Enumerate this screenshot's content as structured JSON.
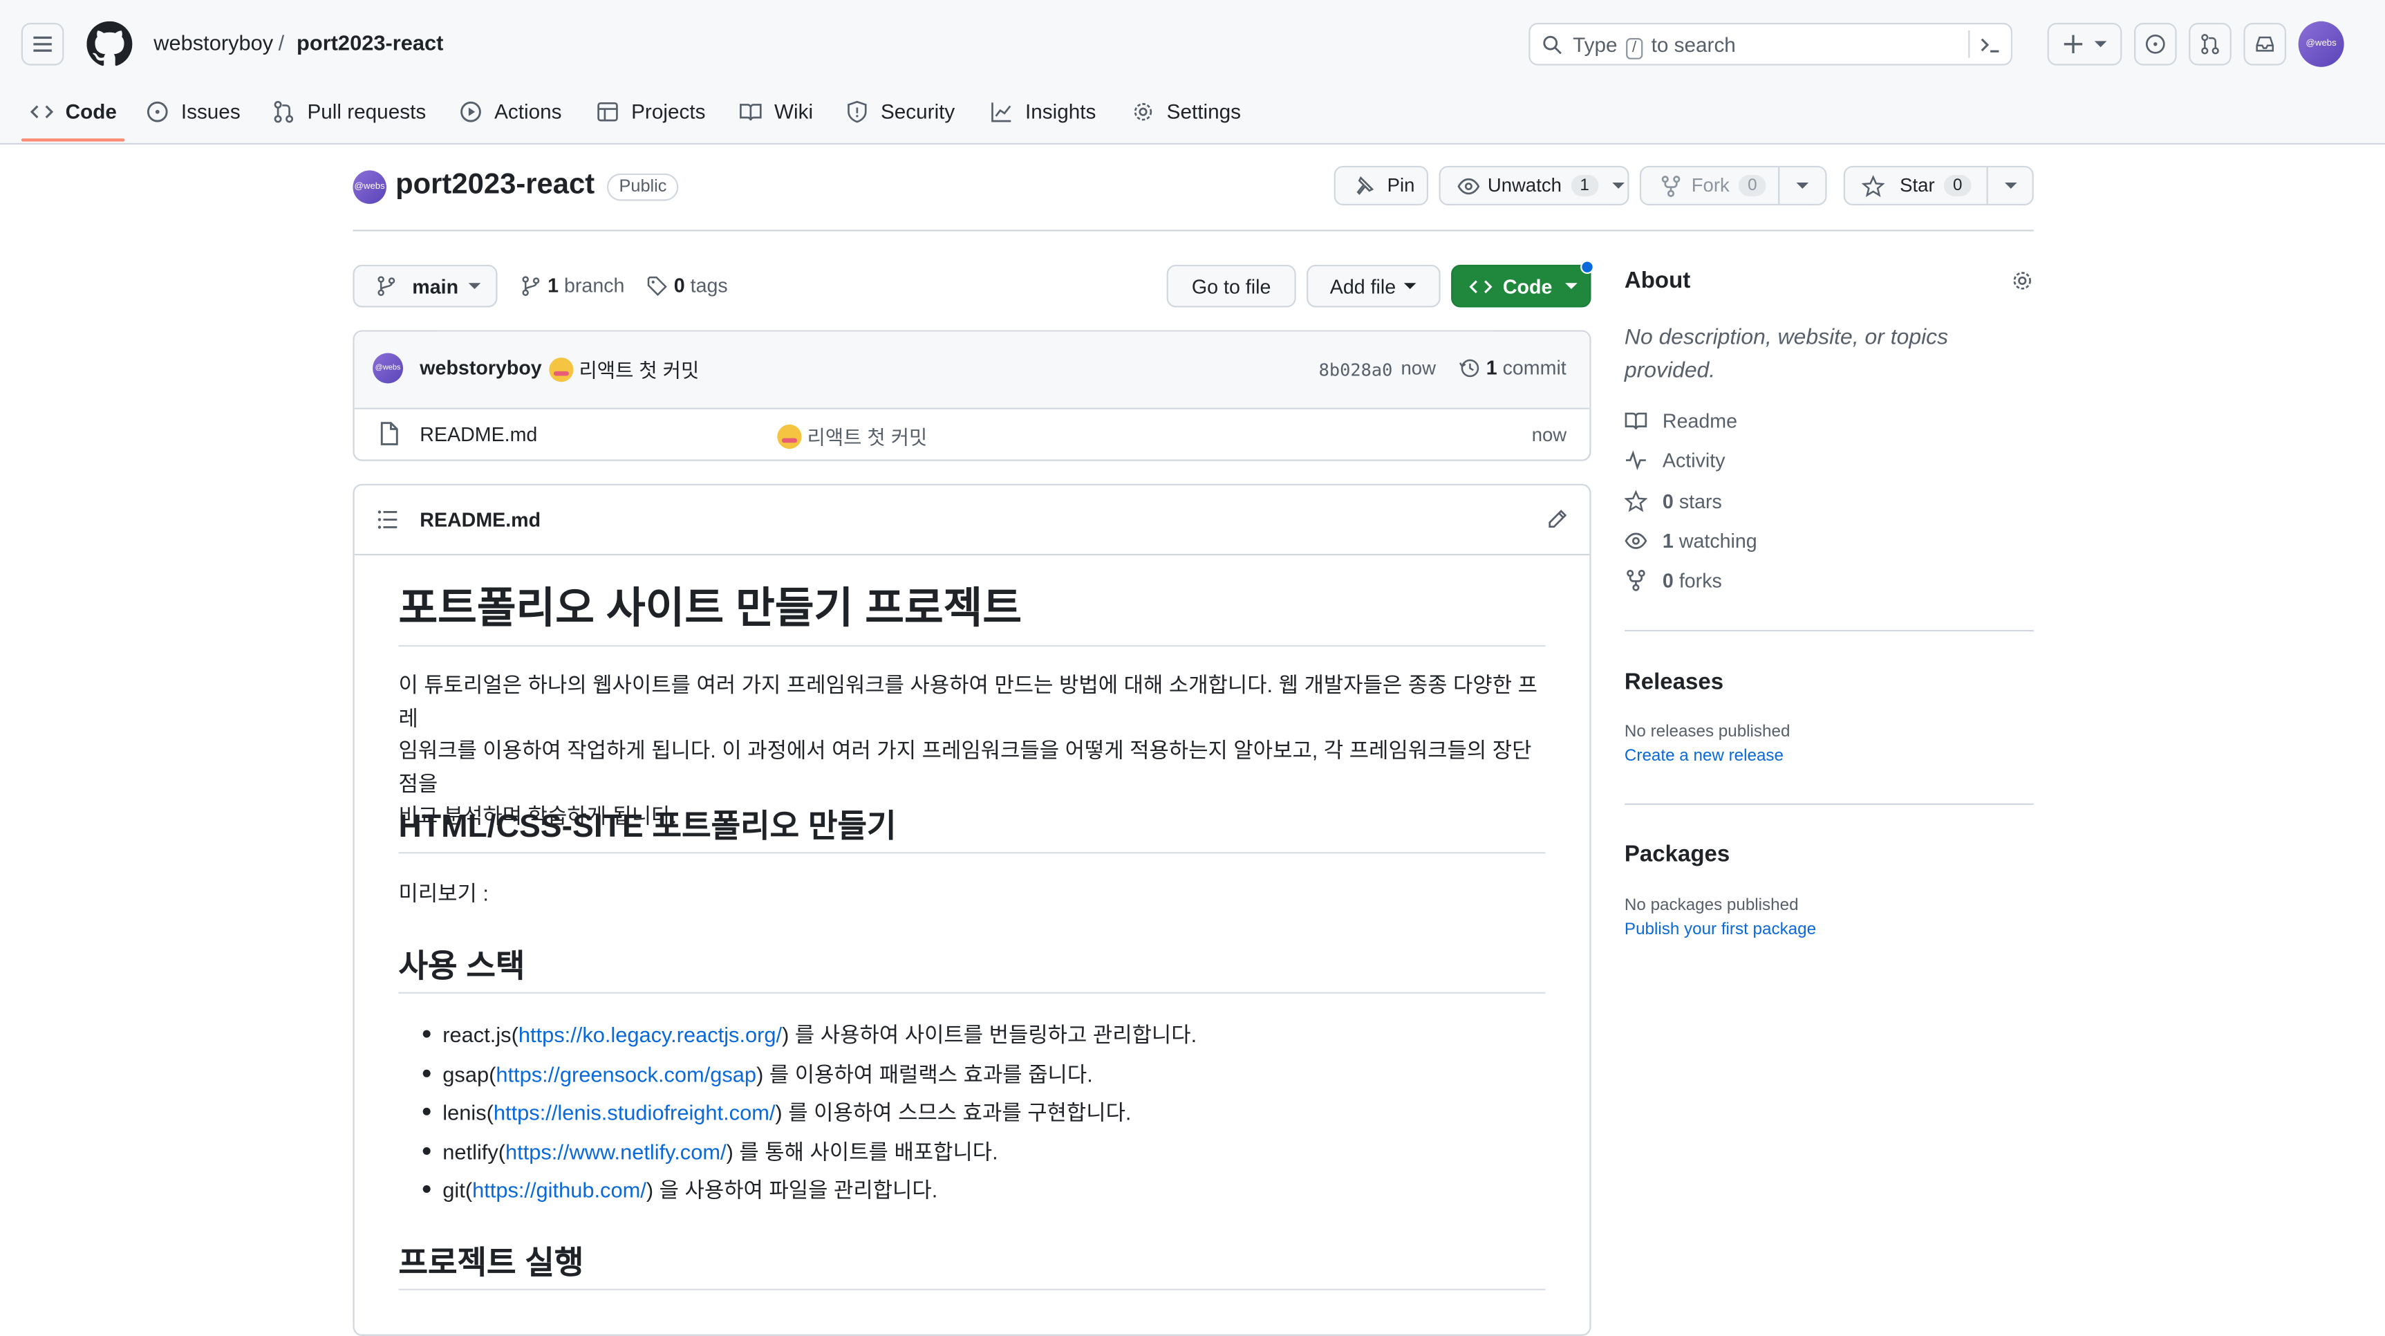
{
  "header": {
    "owner": "webstoryboy",
    "separator": "/",
    "repo": "port2023-react",
    "search_before": "Type",
    "search_key": "/",
    "search_after": "to search",
    "avatar_text": "@webs"
  },
  "nav": {
    "code": "Code",
    "issues": "Issues",
    "pulls": "Pull requests",
    "actions": "Actions",
    "projects": "Projects",
    "wiki": "Wiki",
    "security": "Security",
    "insights": "Insights",
    "settings": "Settings"
  },
  "repo": {
    "name": "port2023-react",
    "visibility": "Public",
    "pin": "Pin",
    "unwatch": "Unwatch",
    "watch_count": "1",
    "fork": "Fork",
    "fork_count": "0",
    "star": "Star",
    "star_count": "0"
  },
  "toolbar": {
    "branch": "main",
    "branches_count": "1",
    "branches_label": "branch",
    "tags_count": "0",
    "tags_label": "tags",
    "go_to_file": "Go to file",
    "add_file": "Add file",
    "code": "Code"
  },
  "commit": {
    "author": "webstoryboy",
    "message": "리액트 첫 커밋",
    "hash": "8b028a0",
    "time": "now",
    "count": "1",
    "count_label": "commit"
  },
  "files": [
    {
      "name": "README.md",
      "message": "리액트 첫 커밋",
      "time": "now"
    }
  ],
  "readme": {
    "filename": "README.md",
    "h1": "포트폴리오 사이트 만들기 프로젝트",
    "intro_1": "이 튜토리얼은 하나의 웹사이트를 여러 가지 프레임워크를 사용하여 만드는 방법에 대해 소개합니다. 웹 개발자들은 종종 다양한 프레",
    "intro_2": "임워크를 이용하여 작업하게 됩니다. 이 과정에서 여러 가지 프레임워크들을 어떻게 적용하는지 알아보고, 각 프레임워크들의 장단점을",
    "intro_3": "비교 분석하며 학습하게 됩니다.",
    "h2_site": "HTML/CSS-SITE 포트폴리오 만들기",
    "preview": "미리보기 :",
    "h2_stack": "사용 스택",
    "stack": [
      {
        "pre": "react.js(",
        "url": "https://ko.legacy.reactjs.org/",
        "post": ") 를 사용하여 사이트를 번들링하고 관리합니다."
      },
      {
        "pre": "gsap(",
        "url": "https://greensock.com/gsap",
        "post": ") 를 이용하여 패럴랙스 효과를 줍니다."
      },
      {
        "pre": "lenis(",
        "url": "https://lenis.studiofreight.com/",
        "post": ") 를 이용하여 스므스 효과를 구현합니다."
      },
      {
        "pre": "netlify(",
        "url": "https://www.netlify.com/",
        "post": ") 를 통해 사이트를 배포합니다."
      },
      {
        "pre": "git(",
        "url": "https://github.com/",
        "post": ") 을 사용하여 파일을 관리합니다."
      }
    ],
    "h2_run": "프로젝트 실행"
  },
  "about": {
    "title": "About",
    "desc_1": "No description, website, or topics",
    "desc_2": "provided.",
    "readme": "Readme",
    "activity": "Activity",
    "stars_count": "0",
    "stars_label": "stars",
    "watching_count": "1",
    "watching_label": "watching",
    "forks_count": "0",
    "forks_label": "forks"
  },
  "releases": {
    "title": "Releases",
    "empty": "No releases published",
    "create": "Create a new release"
  },
  "packages": {
    "title": "Packages",
    "empty": "No packages published",
    "publish": "Publish your first package"
  },
  "colors": {
    "accent_underline": "#fd8c73",
    "code_button": "#1f883d",
    "link": "#0969da"
  }
}
